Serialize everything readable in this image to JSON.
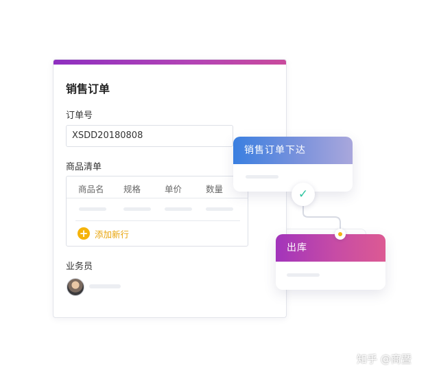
{
  "form": {
    "title": "销售订单",
    "order_no_label": "订单号",
    "order_no_value": "XSDD20180808",
    "goods_label": "商品清单",
    "columns": [
      "商品名",
      "规格",
      "单价",
      "数量"
    ],
    "add_row_label": "添加新行",
    "staff_label": "业务员"
  },
  "flow": {
    "step1_title": "销售订单下达",
    "step1_status_icon": "check-icon",
    "step2_title": "出库"
  },
  "watermark": "知乎 @商暨",
  "colors": {
    "form_top_bar": "#a13cbb",
    "step1_gradient": [
      "#3a7fe0",
      "#a9a7dc"
    ],
    "step2_gradient": [
      "#a234bb",
      "#dc5a93"
    ],
    "accent_yellow": "#f5b30b",
    "check_green": "#2ec4a0"
  }
}
